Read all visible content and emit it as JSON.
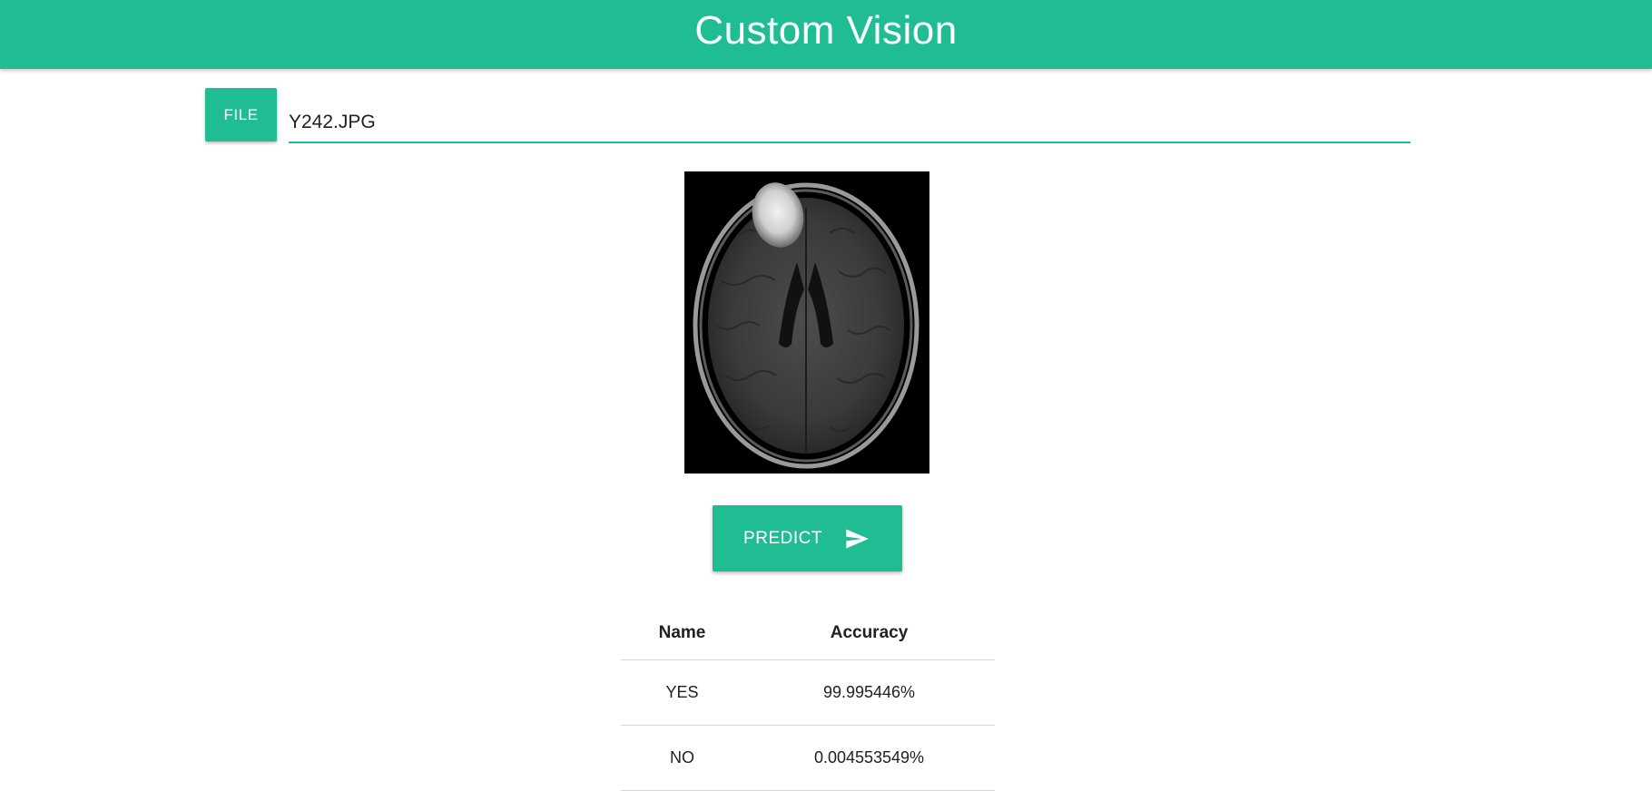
{
  "header": {
    "title": "Custom Vision"
  },
  "upload": {
    "button_label": "FILE",
    "file_name": "Y242.JPG"
  },
  "image": {
    "alt": "Brain MRI scan"
  },
  "predict": {
    "label": "PREDICT",
    "icon": "send-icon"
  },
  "results": {
    "columns": [
      "Name",
      "Accuracy"
    ],
    "rows": [
      {
        "name": "YES",
        "accuracy": "99.995446%"
      },
      {
        "name": "NO",
        "accuracy": "0.004553549%"
      }
    ]
  },
  "colors": {
    "accent": "#20bd94",
    "header_text": "#ffffff",
    "divider": "#d6d6d6"
  }
}
